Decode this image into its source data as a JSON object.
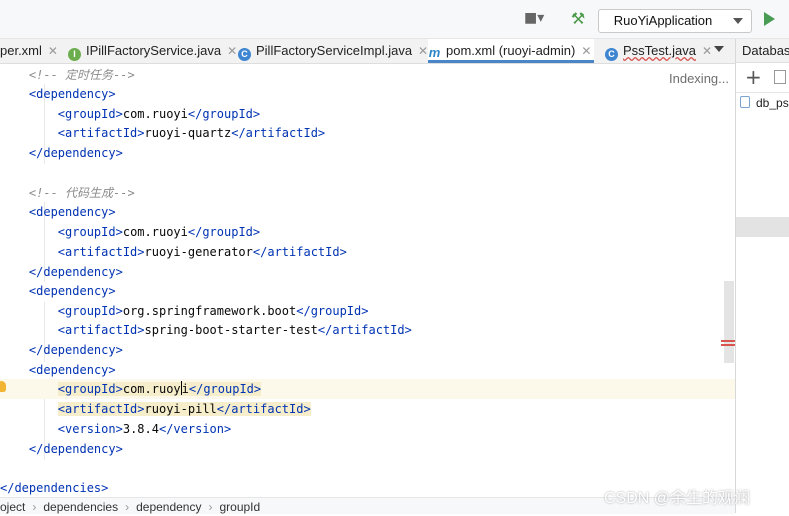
{
  "toolbar": {
    "run_config": "RuoYiApplication"
  },
  "tabs": [
    {
      "label": "per.xml",
      "icon": "xml-file-icon"
    },
    {
      "label": "IPillFactoryService.java",
      "icon_letter": "I",
      "icon_color": "#6cae4e"
    },
    {
      "label": "PillFactoryServiceImpl.java",
      "icon_letter": "C",
      "icon_color": "#3e86d1"
    },
    {
      "label": "pom.xml (ruoyi-admin)",
      "icon_letter": "m",
      "icon_color": "#2f86c7"
    },
    {
      "label": "PssTest.java",
      "icon_letter": "C",
      "icon_color": "#3e86d1"
    }
  ],
  "right_panel": {
    "title": "Database",
    "db_item": "db_ps"
  },
  "editor": {
    "status": "Indexing...",
    "lines": {
      "l1_comment": "<!-- 定时任务-->",
      "dep_open": "dependency",
      "groupId": "groupId",
      "artifactId": "artifactId",
      "version": "version",
      "com_ruoyi": "com.ruoyi",
      "quartz": "ruoyi-quartz",
      "gen_comment": "<!-- 代码生成-->",
      "generator": "ruoyi-generator",
      "spring_group": "org.springframework.boot",
      "spring_test": "spring-boot-starter-test",
      "com_ruoy": "com.ruoy",
      "i": "i",
      "pill": "ruoyi-pill",
      "ver": "3.8.4",
      "deps_close": "dependencies"
    }
  },
  "breadcrumbs": [
    "oject",
    "dependencies",
    "dependency",
    "groupId"
  ],
  "watermark": "CSDN @余生的观澜"
}
